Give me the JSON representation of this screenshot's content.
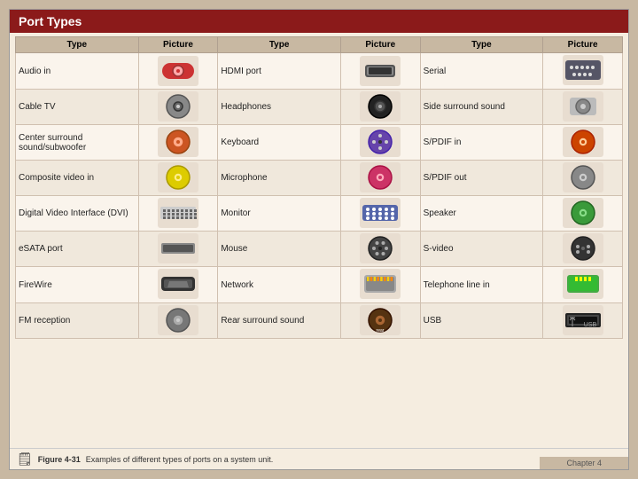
{
  "title": "Port Types",
  "columns": [
    "Type",
    "Picture",
    "Type",
    "Picture",
    "Type",
    "Picture"
  ],
  "rows": [
    [
      {
        "type": "Audio in",
        "pic": "audio_in"
      },
      {
        "type": "HDMI port",
        "pic": "hdmi"
      },
      {
        "type": "Serial",
        "pic": "serial"
      }
    ],
    [
      {
        "type": "Cable TV",
        "pic": "cable_tv"
      },
      {
        "type": "Headphones",
        "pic": "headphones"
      },
      {
        "type": "Side surround sound",
        "pic": "side_surround"
      }
    ],
    [
      {
        "type": "Center surround sound/subwoofer",
        "pic": "center_surround"
      },
      {
        "type": "Keyboard",
        "pic": "keyboard"
      },
      {
        "type": "S/PDIF in",
        "pic": "spdif_in"
      }
    ],
    [
      {
        "type": "Composite video in",
        "pic": "composite"
      },
      {
        "type": "Microphone",
        "pic": "microphone"
      },
      {
        "type": "S/PDIF out",
        "pic": "spdif_out"
      }
    ],
    [
      {
        "type": "Digital Video Interface (DVI)",
        "pic": "dvi"
      },
      {
        "type": "Monitor",
        "pic": "monitor"
      },
      {
        "type": "Speaker",
        "pic": "speaker"
      }
    ],
    [
      {
        "type": "eSATA port",
        "pic": "esata"
      },
      {
        "type": "Mouse",
        "pic": "mouse"
      },
      {
        "type": "S-video",
        "pic": "svideo"
      }
    ],
    [
      {
        "type": "FireWire",
        "pic": "firewire"
      },
      {
        "type": "Network",
        "pic": "network"
      },
      {
        "type": "Telephone line in",
        "pic": "telephone"
      }
    ],
    [
      {
        "type": "FM reception",
        "pic": "fm"
      },
      {
        "type": "Rear surround sound",
        "pic": "rear_surround"
      },
      {
        "type": "USB",
        "pic": "usb"
      }
    ]
  ],
  "footer": {
    "icon": "📋",
    "caption": "Figure 4-31",
    "description": "Examples of different types of ports on a system unit.",
    "chapter": "Chapter 4"
  }
}
